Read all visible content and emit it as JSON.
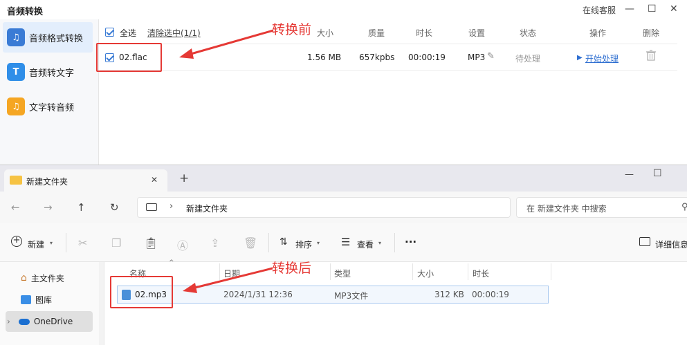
{
  "app": {
    "title": "音频转换",
    "online_service": "在线客服",
    "minimize_glyph": "—",
    "maximize_glyph": "☐",
    "close_glyph": "✕",
    "sidebar": [
      {
        "label": "音频格式转换",
        "icon": "music-note-icon",
        "color": "#3a7bd5",
        "glyph": "♫"
      },
      {
        "label": "音频转文字",
        "icon": "text-T-icon",
        "color": "#2f8ee8",
        "glyph": "T"
      },
      {
        "label": "文字转音频",
        "icon": "audio-file-icon",
        "color": "#f5a623",
        "glyph": "♫"
      }
    ],
    "table": {
      "select_all": "全选",
      "clear_selected": "清除选中(1/1)",
      "headers": {
        "size": "大小",
        "quality": "质量",
        "duration": "时长",
        "settings": "设置",
        "status": "状态",
        "action": "操作",
        "delete": "删除"
      },
      "row": {
        "filename": "02.flac",
        "size": "1.56 MB",
        "quality": "657kpbs",
        "duration": "00:00:19",
        "format": "MP3",
        "status": "待处理",
        "action": "开始处理"
      }
    }
  },
  "annotations": {
    "before": "转换前",
    "after": "转换后",
    "color": "#e53935"
  },
  "explorer": {
    "tab_title": "新建文件夹",
    "tab_close": "✕",
    "new_tab": "+",
    "minimize_glyph": "—",
    "maximize_glyph": "☐",
    "path_crumb": "新建文件夹",
    "search_placeholder": "在 新建文件夹 中搜索",
    "toolbar": {
      "new": "新建",
      "sort": "排序",
      "view": "查看",
      "more": "···",
      "details": "详细信息"
    },
    "nav": [
      {
        "label": "主文件夹",
        "icon": "home-icon"
      },
      {
        "label": "图库",
        "icon": "gallery-icon"
      },
      {
        "label": "OneDrive",
        "icon": "cloud-icon"
      }
    ],
    "columns": {
      "name": "名称",
      "date": "日期",
      "type": "类型",
      "size": "大小",
      "duration": "时长"
    },
    "file": {
      "name": "02.mp3",
      "date": "2024/1/31 12:36",
      "type": "MP3文件",
      "size": "312 KB",
      "duration": "00:00:19"
    }
  }
}
